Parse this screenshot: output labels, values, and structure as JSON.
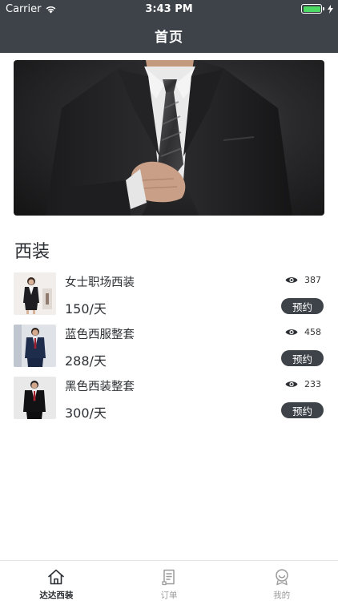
{
  "status_bar": {
    "carrier": "Carrier",
    "time": "3:43 PM"
  },
  "nav": {
    "title": "首页"
  },
  "section": {
    "title": "西装"
  },
  "products": [
    {
      "name": "女士职场西装",
      "price": "150/天",
      "views": "387",
      "button": "预约"
    },
    {
      "name": "蓝色西服整套",
      "price": "288/天",
      "views": "458",
      "button": "预约"
    },
    {
      "name": "黑色西装整套",
      "price": "300/天",
      "views": "233",
      "button": "预约"
    }
  ],
  "tabs": [
    {
      "label": "达达西装",
      "icon": "home-icon",
      "active": true
    },
    {
      "label": "订单",
      "icon": "order-icon",
      "active": false
    },
    {
      "label": "我的",
      "icon": "profile-icon",
      "active": false
    }
  ],
  "colors": {
    "header": "#3e434a",
    "battery": "#4cd964",
    "text": "#2b2f33",
    "inactive_tab": "#9b9b9b"
  }
}
